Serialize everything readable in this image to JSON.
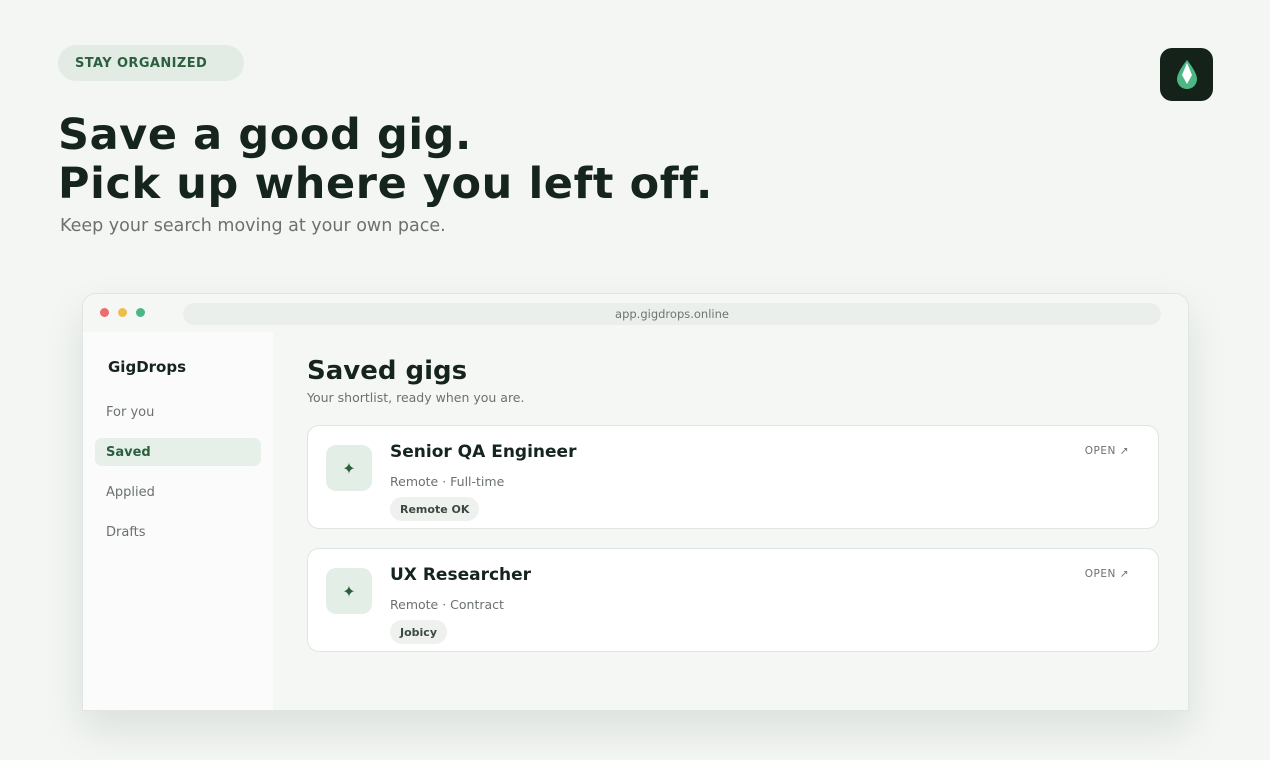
{
  "hero": {
    "pill_label": "STAY ORGANIZED",
    "headline_line1": "Save a good gig.",
    "headline_line2": "Pick up where you left off.",
    "subhead": "Keep your search moving at your own pace.",
    "logo_icon": "drop-icon"
  },
  "browser": {
    "url": "app.gigdrops.online",
    "window_controls": [
      "close-dot",
      "minimize-dot",
      "maximize-dot"
    ]
  },
  "sidebar": {
    "brand": "GigDrops",
    "items": [
      {
        "label": "For you",
        "active": false
      },
      {
        "label": "Saved",
        "active": true
      },
      {
        "label": "Applied",
        "active": false
      },
      {
        "label": "Drafts",
        "active": false
      }
    ]
  },
  "main": {
    "title": "Saved gigs",
    "subtitle": "Your shortlist, ready when you are.",
    "cards": [
      {
        "title": "Senior QA Engineer",
        "meta": "Remote · Full-time",
        "tag": "Remote OK",
        "action": "OPEN ↗",
        "icon": "sparkle-icon"
      },
      {
        "title": "UX Researcher",
        "meta": "Remote · Contract",
        "tag": "Jobicy",
        "action": "OPEN ↗",
        "icon": "sparkle-icon"
      }
    ]
  },
  "colors": {
    "accent": "#2c5f3e",
    "background": "#f3f6f3",
    "dark": "#142219",
    "brand_green": "#4cb784"
  }
}
